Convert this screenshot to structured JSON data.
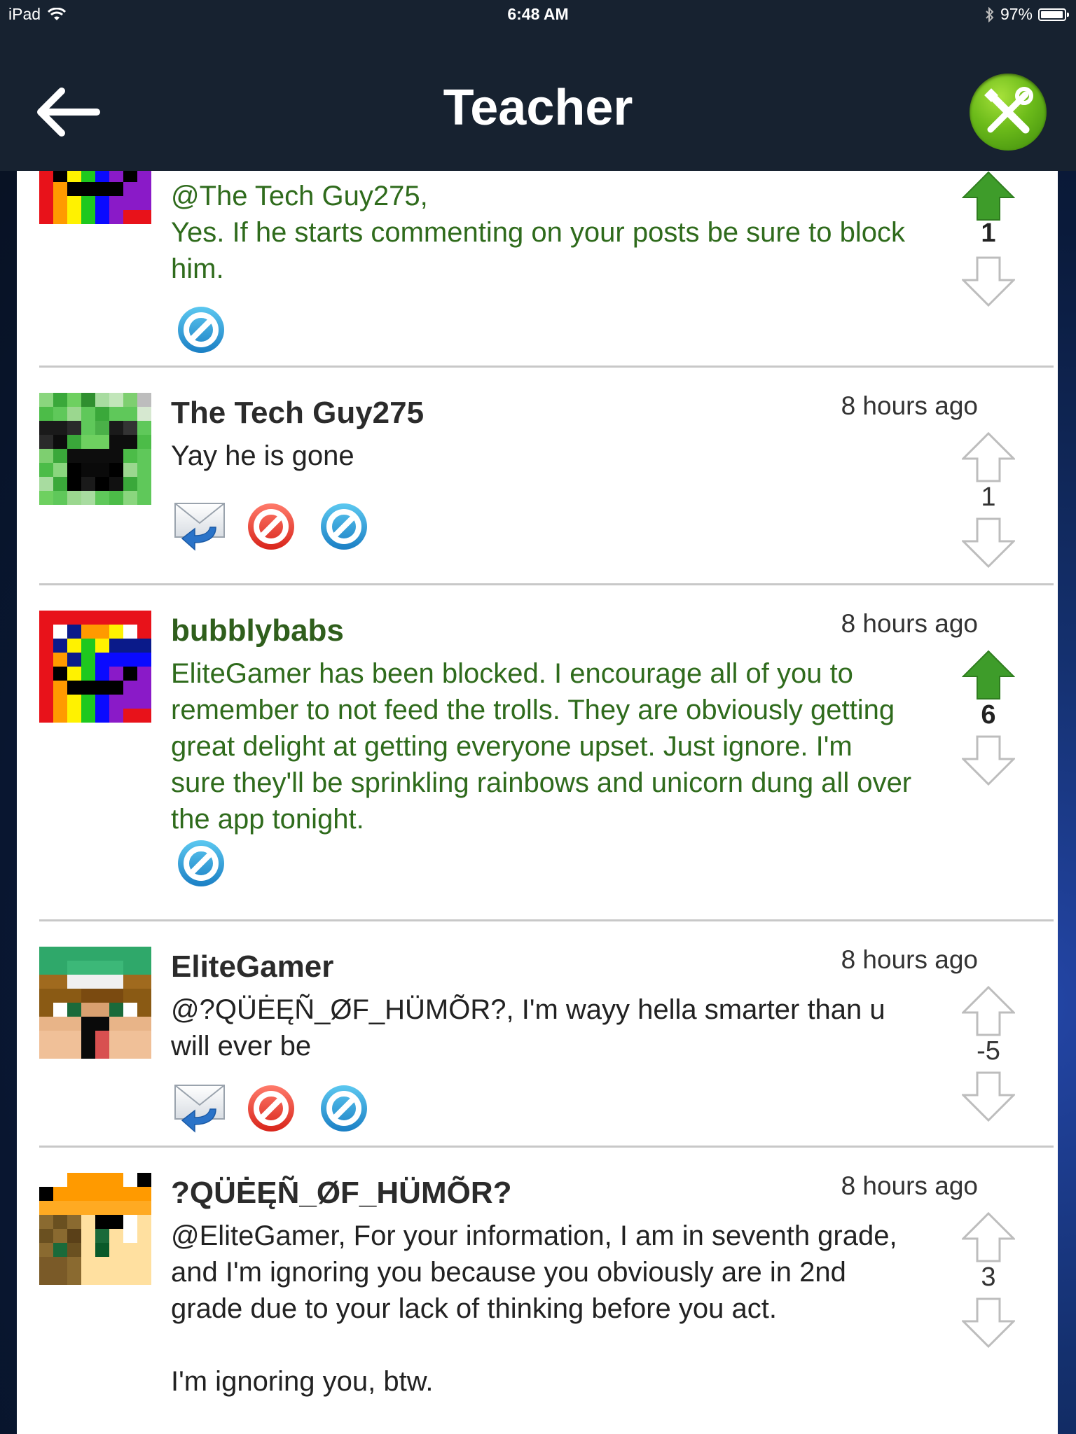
{
  "status_bar": {
    "device": "iPad",
    "time": "6:48 AM",
    "battery": "97%"
  },
  "header": {
    "title": "Teacher"
  },
  "comments": [
    {
      "author": "",
      "time": "",
      "body": "@The Tech Guy275,\nYes. If he starts commenting on your posts be sure to block him.",
      "score": "1",
      "upvoted": true,
      "actions": [
        "block-icon"
      ]
    },
    {
      "author": "The Tech Guy275",
      "time": "8 hours ago",
      "body": "Yay he is gone",
      "score": "1",
      "upvoted": false,
      "actions": [
        "reply-mail-icon",
        "report-icon",
        "block-icon"
      ]
    },
    {
      "author": "bubblybabs",
      "time": "8 hours ago",
      "body": "EliteGamer has been blocked. I encourage all of you to remember to not feed the trolls. They are obviously getting great delight at getting everyone upset. Just ignore. I'm sure they'll be sprinkling rainbows and unicorn dung all over the app tonight.",
      "score": "6",
      "upvoted": true,
      "actions": [
        "block-icon"
      ]
    },
    {
      "author": "EliteGamer",
      "time": "8 hours ago",
      "body": "@?QÜĖĘÑ_ØF_HÜMÕR?, I'm wayy hella smarter than u will ever be",
      "score": "-5",
      "upvoted": false,
      "actions": [
        "reply-mail-icon",
        "report-icon",
        "block-icon"
      ]
    },
    {
      "author": "?QÜĖĘÑ_ØF_HÜMÕR?",
      "time": "8 hours ago",
      "body": "@EliteGamer, For your information, I am in seventh grade, and I'm ignoring you because you obviously are in 2nd grade due to your lack of thinking before you act.\n\nI'm ignoring you, btw.",
      "score": "3",
      "upvoted": false,
      "actions": []
    }
  ],
  "colors": {
    "nav_bg": "#172230",
    "upvote_green": "#3e9c2a",
    "author_green": "#2f5e1c"
  }
}
